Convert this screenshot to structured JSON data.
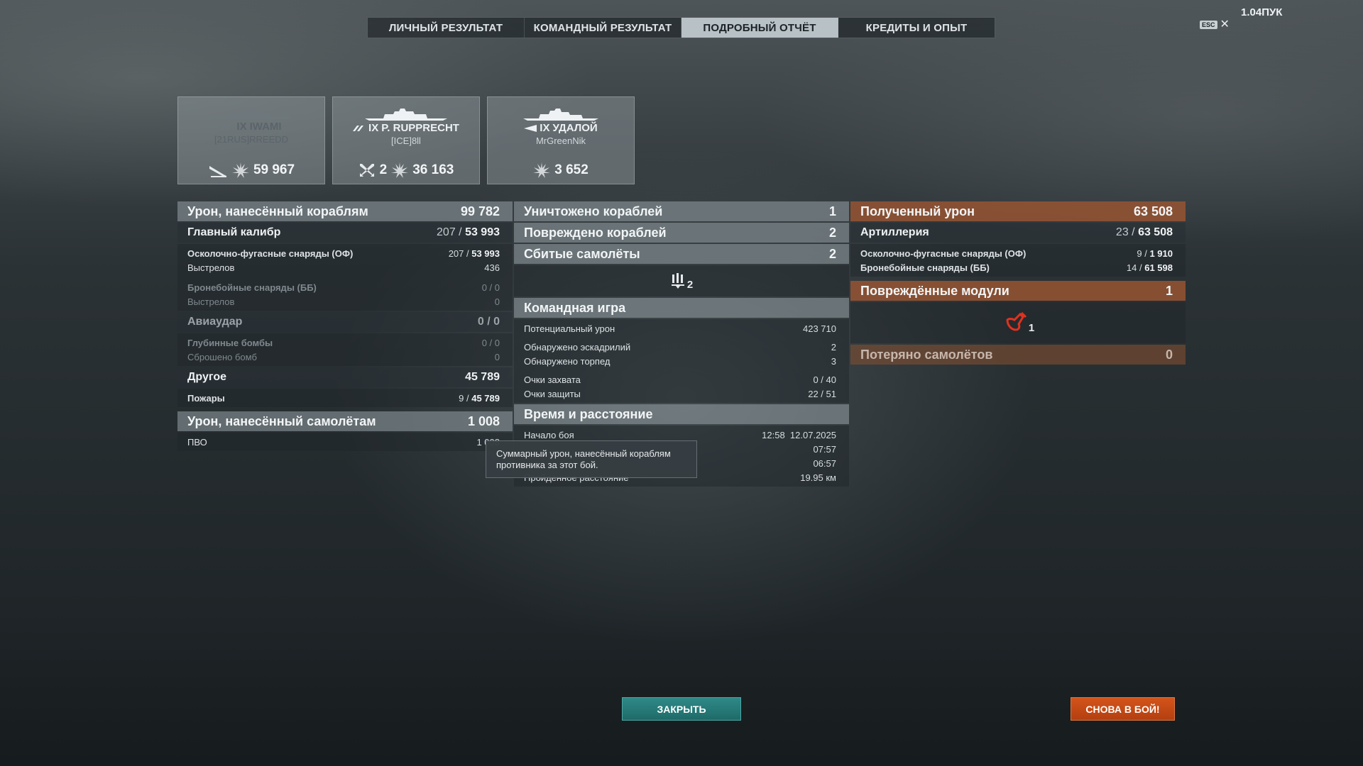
{
  "version": "1.04ПУК",
  "esc": {
    "key": "ESC",
    "close": "✕"
  },
  "tabs": [
    {
      "label": "ЛИЧНЫЙ РЕЗУЛЬТАТ"
    },
    {
      "label": "КОМАНДНЫЙ РЕЗУЛЬТАТ"
    },
    {
      "label": "ПОДРОБНЫЙ ОТЧЁТ",
      "active": true
    },
    {
      "label": "КРЕДИТЫ И ОПЫТ"
    }
  ],
  "ships": [
    {
      "tier": "IX",
      "name": "IWAMI",
      "player": "[21RUS]RREEDD",
      "stat1": "",
      "stat2": "59 967",
      "dim": true
    },
    {
      "tier": "IX",
      "name": "P. RUPPRECHT",
      "player": "[ICE]8ll",
      "stat1": "2",
      "stat2": "36 163"
    },
    {
      "tier": "IX",
      "name": "УДАЛОЙ",
      "player": "MrGreenNik",
      "stat1": "",
      "stat2": "3 652"
    }
  ],
  "left": {
    "damage_header": {
      "label": "Урон, нанесённый кораблям",
      "value": "99 782"
    },
    "main_caliber": {
      "label": "Главный калибр",
      "hits": "207",
      "sep": " / ",
      "dmg": "53 993"
    },
    "he": {
      "label": "Осколочно-фугасные снаряды (ОФ)",
      "hits": "207",
      "sep": " / ",
      "dmg": "53 993"
    },
    "he_shots": {
      "label": "Выстрелов",
      "value": "436"
    },
    "ap": {
      "label": "Бронебойные снаряды (ББ)",
      "value": "0 / 0"
    },
    "ap_shots": {
      "label": "Выстрелов",
      "value": "0"
    },
    "airstrike": {
      "label": "Авиаудар",
      "value": "0 / 0"
    },
    "depth_charges": {
      "label": "Глубинные бомбы",
      "value": "0 / 0"
    },
    "bombs_dropped": {
      "label": "Сброшено бомб",
      "value": "0"
    },
    "other": {
      "label": "Другое",
      "value": "45 789"
    },
    "fires": {
      "label": "Пожары",
      "hits": "9",
      "sep": " / ",
      "dmg": "45 789"
    },
    "plane_damage": {
      "label": "Урон, нанесённый самолётам",
      "value": "1 008"
    },
    "aa": {
      "label": "ПВО",
      "value": "1 008"
    }
  },
  "middle": {
    "destroyed": {
      "label": "Уничтожено кораблей",
      "value": "1"
    },
    "damaged": {
      "label": "Повреждено кораблей",
      "value": "2"
    },
    "planes_shot": {
      "label": "Сбитые самолёты",
      "value": "2"
    },
    "planes_icon_count": "2",
    "teamplay": {
      "label": "Командная игра"
    },
    "potential": {
      "label": "Потенциальный урон",
      "value": "423 710"
    },
    "squadrons": {
      "label": "Обнаружено эскадрилий",
      "value": "2"
    },
    "torpedoes": {
      "label": "Обнаружено торпед",
      "value": "3"
    },
    "capture": {
      "label": "Очки захвата",
      "value": "0 / 40"
    },
    "defense": {
      "label": "Очки защиты",
      "value": "22 / 51"
    },
    "time": {
      "label": "Время и расстояние"
    },
    "battle_start": {
      "label": "Начало боя",
      "time": "12:58",
      "date": "12.07.2025"
    },
    "t2": {
      "label": "",
      "value": "07:57"
    },
    "t3": {
      "label": "",
      "value": "06:57"
    },
    "distance": {
      "label": "Пройденное расстояние",
      "value": "19.95 км"
    }
  },
  "right": {
    "received": {
      "label": "Полученный урон",
      "value": "63 508"
    },
    "artillery": {
      "label": "Артиллерия",
      "hits": "23",
      "sep": " / ",
      "dmg": "63 508"
    },
    "he": {
      "label": "Осколочно-фугасные снаряды (ОФ)",
      "hits": "9",
      "sep": " / ",
      "dmg": "1 910"
    },
    "ap": {
      "label": "Бронебойные снаряды (ББ)",
      "hits": "14",
      "sep": " / ",
      "dmg": "61 598"
    },
    "modules": {
      "label": "Повреждённые модули",
      "value": "1"
    },
    "module_icon_count": "1",
    "planes_lost": {
      "label": "Потеряно самолётов",
      "value": "0"
    }
  },
  "tooltip": {
    "text": "Суммарный урон, нанесённый кораблям противника за этот бой."
  },
  "buttons": {
    "close": "ЗАКРЫТЬ",
    "again": "СНОВА В БОЙ!"
  },
  "colors": {
    "accent_teal": "#2e8a88",
    "accent_orange": "#d4541a",
    "received_header": "#965532"
  }
}
